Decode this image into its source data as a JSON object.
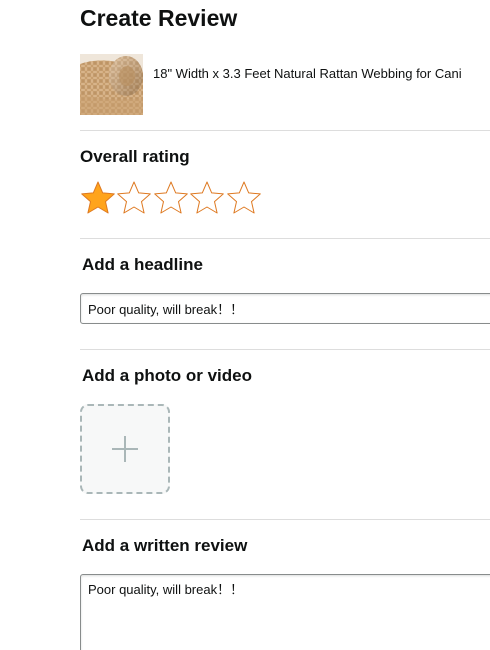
{
  "page": {
    "title": "Create Review"
  },
  "product": {
    "name": "18\" Width x 3.3 Feet Natural Rattan Webbing for Cani",
    "thumbnail_icon": "rattan-webbing-roll-image"
  },
  "rating": {
    "heading": "Overall rating",
    "value": 1,
    "max": 5,
    "filled_color": "#ffa41c",
    "outline_color": "#de7921"
  },
  "headline": {
    "heading": "Add a headline",
    "value": "Poor quality, will break！！"
  },
  "media": {
    "heading": "Add a photo or video",
    "upload_icon": "plus-icon"
  },
  "written_review": {
    "heading": "Add a written review",
    "value": "Poor quality, will break！！"
  }
}
